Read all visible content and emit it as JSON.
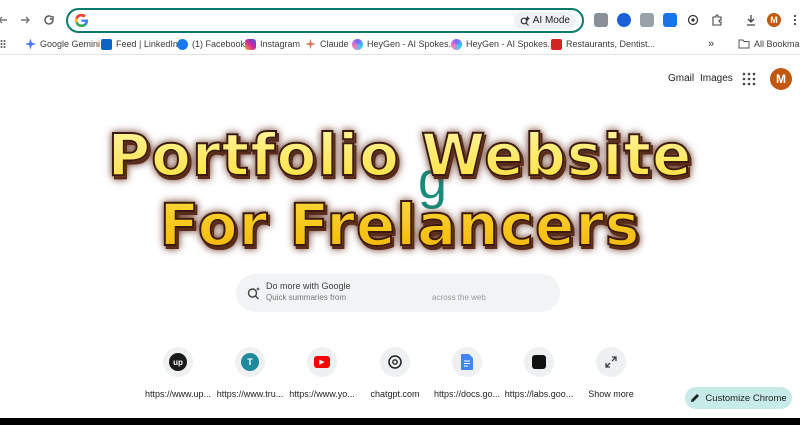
{
  "toolbar": {
    "ai_mode_label": "AI Mode",
    "profile_initial": "M"
  },
  "bookmarks": [
    {
      "label": "Google Gemini",
      "icon": "gemini-icon",
      "color": "#4a7cf7"
    },
    {
      "label": "Feed | LinkedIn",
      "icon": "linkedin-icon",
      "color": "#0a66c2"
    },
    {
      "label": "(1) Facebook",
      "icon": "facebook-icon",
      "color": "#1877f2"
    },
    {
      "label": "Instagram",
      "icon": "instagram-icon",
      "color": "#d6249f"
    },
    {
      "label": "Claude",
      "icon": "claude-icon",
      "color": "#d97757"
    },
    {
      "label": "HeyGen - AI Spokes...",
      "icon": "heygen-icon",
      "color": "#7b61ff"
    },
    {
      "label": "HeyGen - AI Spokes...",
      "icon": "heygen-icon",
      "color": "#7b61ff"
    },
    {
      "label": "Restaurants, Dentist...",
      "icon": "yelp-icon",
      "color": "#d32323"
    }
  ],
  "all_bookmarks_label": "All Bookmarks",
  "header": {
    "gmail": "Gmail",
    "images": "Images",
    "avatar_initial": "M"
  },
  "background": {
    "logo_fragment": "g",
    "search_title": "Do more with Google",
    "search_sub": "Quick summaries from",
    "search_right": "across the web"
  },
  "overlay": {
    "line1": "Portfolio Website",
    "line2": "For Frelancers"
  },
  "shortcuts": [
    {
      "label": "https://www.up...",
      "icon": "upwork-icon",
      "glyph": "up",
      "bg": "#1a1a1a",
      "fg": "#ffffff"
    },
    {
      "label": "https://www.tru...",
      "icon": "trustpilot-icon",
      "glyph": "T",
      "bg": "#1e8a9c",
      "fg": "#ffffff"
    },
    {
      "label": "https://www.yo...",
      "icon": "youtube-icon",
      "glyph": "▶",
      "bg": "#ff0000",
      "fg": "#ffffff"
    },
    {
      "label": "chatgpt.com",
      "icon": "chatgpt-icon",
      "glyph": "✺",
      "bg": "transparent",
      "fg": "#1f1f1f"
    },
    {
      "label": "https://docs.go...",
      "icon": "google-docs-icon",
      "glyph": "≡",
      "bg": "#4285f4",
      "fg": "#ffffff"
    },
    {
      "label": "https://labs.goo...",
      "icon": "google-labs-icon",
      "glyph": "■",
      "bg": "transparent",
      "fg": "#111111"
    },
    {
      "label": "Show more",
      "icon": "expand-icon",
      "glyph": "⤢",
      "bg": "transparent",
      "fg": "#3c3c3c"
    }
  ],
  "customize_label": "Customize Chrome",
  "colors": {
    "omnibox_border": "#0b7a6f",
    "avatar": "#c25710",
    "customize_bg": "#c7ebe8",
    "overlay_text": "#ffe34a"
  }
}
